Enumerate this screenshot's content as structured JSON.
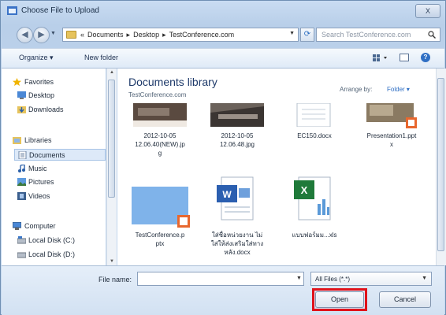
{
  "window": {
    "title": "Choose File to Upload",
    "close_label": "X"
  },
  "address": {
    "crumbs": [
      "«",
      "Documents",
      "▸",
      "Desktop",
      "▸",
      "TestConference.com"
    ]
  },
  "search": {
    "placeholder": "Search TestConference.com"
  },
  "toolbar": {
    "organize_label": "Organize ▾",
    "new_folder_label": "New folder"
  },
  "sidebar": {
    "items": [
      {
        "label": "Favorites",
        "icon": "star-icon"
      },
      {
        "label": "Desktop",
        "icon": "desktop-icon"
      },
      {
        "label": "Downloads",
        "icon": "downloads-icon"
      },
      {
        "label": "Libraries",
        "icon": "libraries-icon"
      },
      {
        "label": "Documents",
        "icon": "documents-icon",
        "selected": true
      },
      {
        "label": "Music",
        "icon": "music-icon"
      },
      {
        "label": "Pictures",
        "icon": "pictures-icon"
      },
      {
        "label": "Videos",
        "icon": "videos-icon"
      },
      {
        "label": "Computer",
        "icon": "computer-icon"
      },
      {
        "label": "Local Disk (C:)",
        "icon": "disk-icon"
      },
      {
        "label": "Local Disk (D:)",
        "icon": "disk-icon"
      }
    ]
  },
  "library": {
    "title": "Documents library",
    "subtitle": "TestConference.com",
    "arrange_label": "Arrange by:",
    "arrange_value": "Folder ▾"
  },
  "files": [
    {
      "name": "2012-10-05 12.06.40(NEW).jpg",
      "lines": [
        "2012-10-05",
        "12.06.40(NEW).jp",
        "g"
      ],
      "type": "photo"
    },
    {
      "name": "2012-10-05 12.06.48.jpg",
      "lines": [
        "2012-10-05",
        "12.06.48.jpg"
      ],
      "type": "photo"
    },
    {
      "name": "EC150.docx",
      "lines": [
        "EC150.docx"
      ],
      "type": "doc"
    },
    {
      "name": "Presentation1.pptx",
      "lines": [
        "Presentation1.ppt",
        "x"
      ],
      "type": "pptx"
    },
    {
      "name": "TestConference.pptx",
      "lines": [
        "TestConference.p",
        "ptx"
      ],
      "type": "pptx-blue"
    },
    {
      "name": "ใส่ชื่อหน่วยงาน ไม่ใส่ให้ส่งเสริมใส่ทาง หลัง.docx",
      "lines": [
        "ใส่ชื่อหน่วยงาน ไม่",
        "ใส่ให้ส่งเสริมใส่ทาง",
        "หลัง.docx"
      ],
      "type": "word"
    },
    {
      "name": "แบบฟอร์มม...xls",
      "lines": [
        "แบบฟอร์มม...xls"
      ],
      "type": "excel"
    }
  ],
  "bottom": {
    "filename_label": "File name:",
    "filename_value": "",
    "filter_value": "All Files (*.*)",
    "open_label": "Open",
    "cancel_label": "Cancel"
  },
  "colors": {
    "highlight": "#e0121a",
    "accent": "#2f6fc4"
  }
}
